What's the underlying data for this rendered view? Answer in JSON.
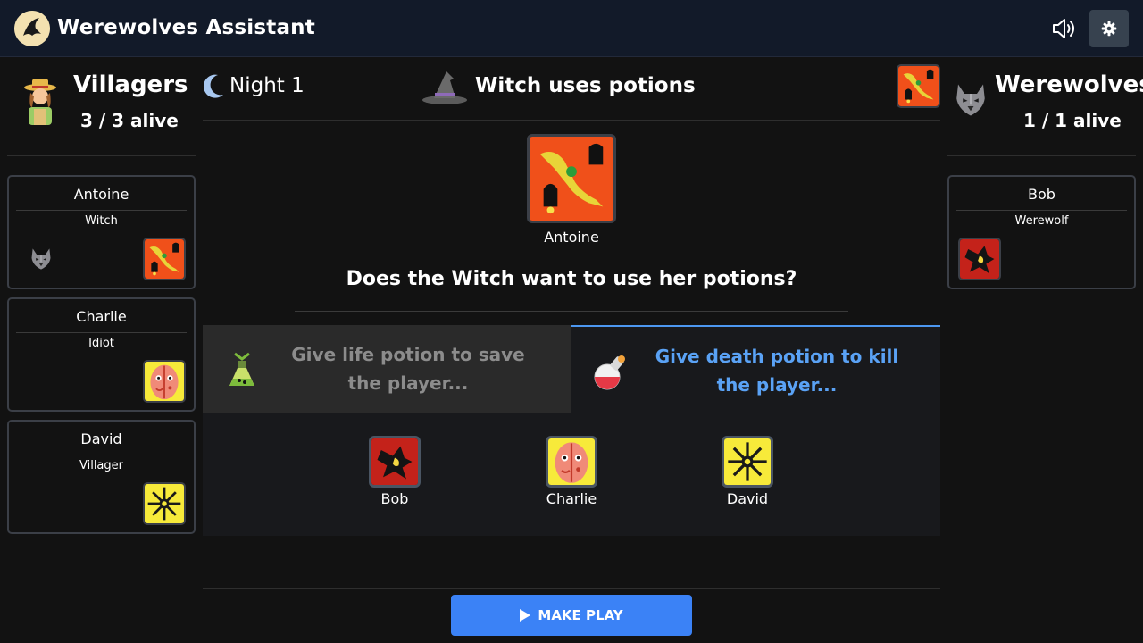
{
  "app": {
    "title": "Werewolves Assistant"
  },
  "header_icons": {
    "sound": "speaker-icon",
    "settings": "gear-icon"
  },
  "villagers": {
    "name": "Villagers",
    "count": "3 / 3 alive"
  },
  "werewolves": {
    "name": "Werewolves",
    "count": "1 / 1 alive"
  },
  "players_left": [
    {
      "name": "Antoine",
      "role": "Witch"
    },
    {
      "name": "Charlie",
      "role": "Idiot"
    },
    {
      "name": "David",
      "role": "Villager"
    }
  ],
  "players_right": [
    {
      "name": "Bob",
      "role": "Werewolf"
    }
  ],
  "phase": {
    "night": "Night 1",
    "step": "Witch uses potions"
  },
  "current": {
    "player": "Antoine",
    "question": "Does the Witch want to use her potions?"
  },
  "tabs": {
    "life": "Give life potion to save the player...",
    "death": "Give death potion to kill the player..."
  },
  "targets": [
    {
      "name": "Bob"
    },
    {
      "name": "Charlie"
    },
    {
      "name": "David"
    }
  ],
  "actions": {
    "make_play": "MAKE PLAY"
  },
  "colors": {
    "accent": "#3b82f6",
    "active_tab": "#5aa2f5",
    "topbar": "#121a29",
    "background": "#121212"
  }
}
